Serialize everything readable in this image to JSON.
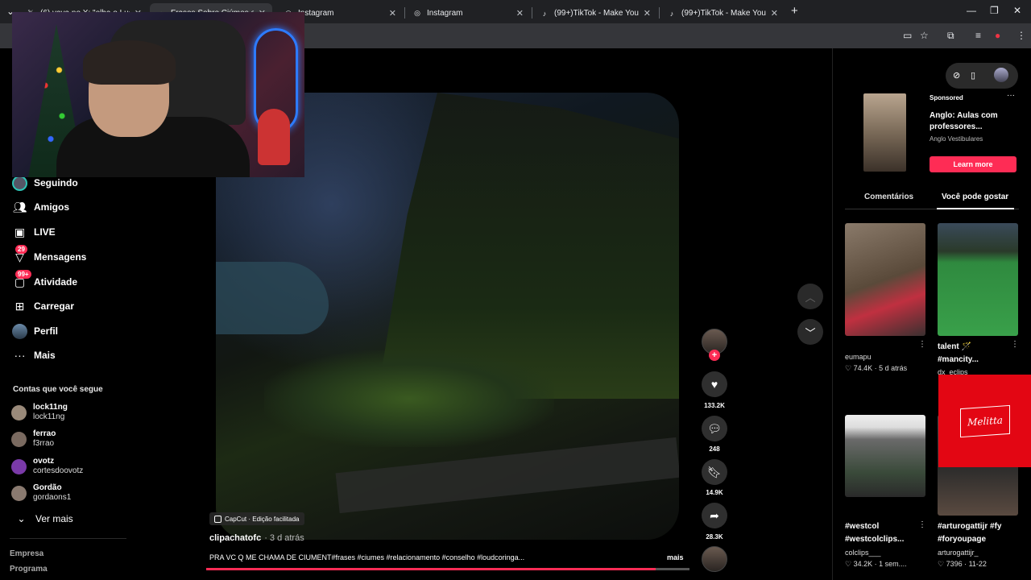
{
  "browser": {
    "tabs": [
      {
        "title": "(6) vava no X: \"olha o Luan KKK",
        "icon": "x-logo-icon"
      },
      {
        "title": "Frases Sobre Ciúmes e Rela",
        "icon": "tiktok-icon"
      },
      {
        "title": "Instagram",
        "icon": "instagram-icon"
      },
      {
        "title": "Instagram",
        "icon": "instagram-icon"
      },
      {
        "title": "(99+)TikTok - Make Your Day",
        "icon": "tiktok-icon"
      },
      {
        "title": "(99+)TikTok - Make Your Day",
        "icon": "tiktok-icon"
      }
    ],
    "new_tab": "+"
  },
  "sidebar": {
    "nav": [
      {
        "label": "Seguindo",
        "icon": "following-avatar-icon"
      },
      {
        "label": "Amigos",
        "icon": "friends-icon"
      },
      {
        "label": "LIVE",
        "icon": "live-icon"
      },
      {
        "label": "Mensagens",
        "icon": "messages-icon",
        "badge": "29"
      },
      {
        "label": "Atividade",
        "icon": "activity-icon",
        "badge": "99+"
      },
      {
        "label": "Carregar",
        "icon": "upload-icon"
      },
      {
        "label": "Perfil",
        "icon": "profile-avatar-icon"
      },
      {
        "label": "Mais",
        "icon": "more-icon"
      }
    ],
    "following_title": "Contas que você segue",
    "accounts": [
      {
        "name": "lock11ng",
        "handle": "lock11ng"
      },
      {
        "name": "ferrao",
        "handle": "f3rrao"
      },
      {
        "name": "ovotz",
        "handle": "cortesdoovotz"
      },
      {
        "name": "Gordão",
        "handle": "gordaons1"
      }
    ],
    "see_more": "Ver mais",
    "footer": [
      "Empresa",
      "Programa"
    ]
  },
  "video": {
    "capcut": "CapCut · Edição facilitada",
    "author": "clipachatofc",
    "time": "· 3 d atrás",
    "description": "PRA VC Q ME CHAMA DE CIUMENT#frases #ciumes #relacionamento #conselho #loudcoringa...",
    "more": "mais",
    "progress": 0.93
  },
  "actions": {
    "likes": "133.2K",
    "comments": "248",
    "saves": "14.9K",
    "shares": "28.3K"
  },
  "ad": {
    "sponsored": "Sponsored",
    "title": "Anglo: Aulas com professores...",
    "advertiser": "Anglo Vestibulares",
    "cta": "Learn more"
  },
  "right_tabs": {
    "comments": "Comentários",
    "suggested": "Você pode gostar"
  },
  "suggested": [
    {
      "caption": "",
      "user": "eumapu",
      "stats": "♡ 74.4K · 5 d atrás"
    },
    {
      "caption": "talent 🪄 #mancity...",
      "user": "dx_eclips",
      "stats": ""
    },
    {
      "caption": "#westcol #westcolclips...",
      "user": "colclips___",
      "stats": "♡ 34.2K · 1 sem...."
    },
    {
      "caption": "#arturogattijr #fy #foryoupage",
      "user": "arturogattijr_",
      "stats": "♡ 7396 · 11-22"
    }
  ],
  "overlay": {
    "brand": "Melitta"
  }
}
